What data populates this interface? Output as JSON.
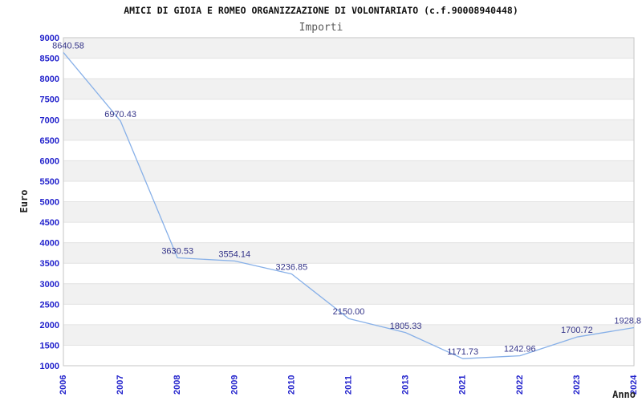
{
  "chart_data": {
    "type": "line",
    "title": "AMICI DI GIOIA E ROMEO ORGANIZZAZIONE DI VOLONTARIATO (c.f.90008940448)",
    "subtitle": "Importi",
    "xlabel": "Anno",
    "ylabel": "Euro",
    "categories": [
      "2006",
      "2007",
      "2008",
      "2009",
      "2010",
      "2011",
      "2013",
      "2021",
      "2022",
      "2023",
      "2024"
    ],
    "values": [
      8640.58,
      6970.43,
      3630.53,
      3554.14,
      3236.85,
      2150.0,
      1805.33,
      1171.73,
      1242.96,
      1700.72,
      1928.8
    ],
    "point_labels": [
      "8640.58",
      "6970.43",
      "3630.53",
      "3554.14",
      "3236.85",
      "2150.00",
      "1805.33",
      "1171.73",
      "1242.96",
      "1700.72",
      "1928.8"
    ],
    "ylim": [
      1000,
      9000
    ],
    "ytick_step": 500,
    "grid": "alternating-horizontal-bands",
    "legend": "none",
    "colors": {
      "line": "#87b0e8",
      "axis_ticks": "#2222cc",
      "point_labels": "#333388",
      "band": "#f1f1f1",
      "gridline": "#e2e2e2",
      "frame": "#c6c6c6",
      "title": "#111111",
      "subtitle": "#5a5a5a",
      "axis_titles": "#222222",
      "background": "#ffffff"
    }
  }
}
